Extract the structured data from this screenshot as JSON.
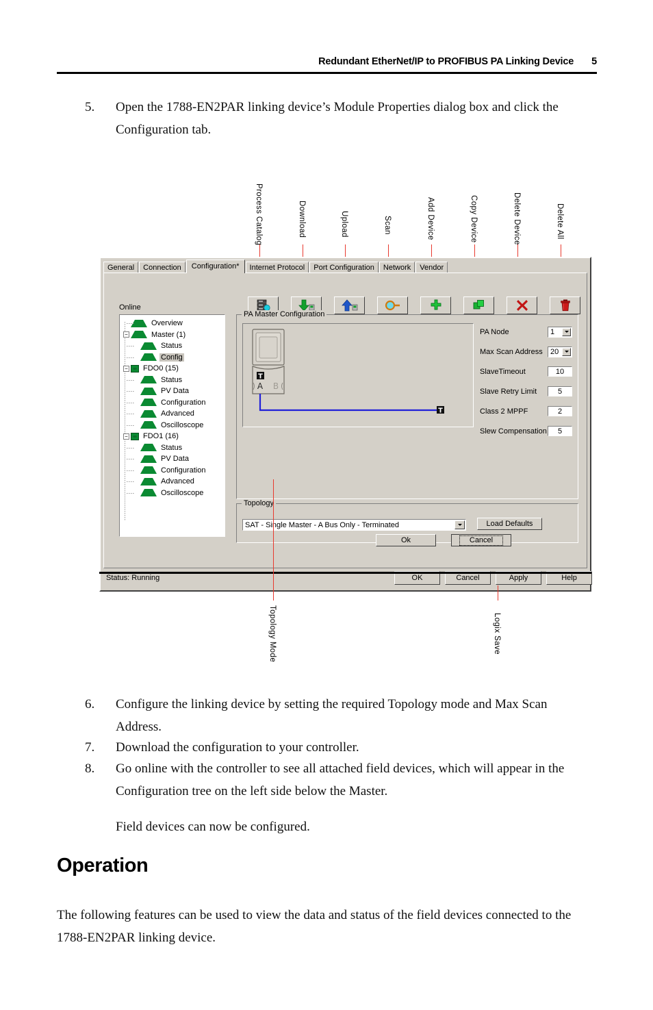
{
  "header": {
    "title": "Redundant EtherNet/IP to PROFIBUS PA Linking Device",
    "page_number": "5"
  },
  "steps": [
    {
      "num": "5.",
      "text": "Open the 1788-EN2PAR linking device’s Module Properties dialog box and click the Configuration tab."
    },
    {
      "num": "6.",
      "text": "Configure the linking device by setting the required Topology mode and Max Scan Address."
    },
    {
      "num": "7.",
      "text": "Download the configuration to your controller."
    },
    {
      "num": "8.",
      "text": "Go online with the controller to see all attached field devices, which will appear in the Configuration tree on the left side below the Master."
    }
  ],
  "note": "Field devices can now be configured.",
  "section": {
    "heading": "Operation",
    "paragraph": "The following features can be used to view the data and status of the field devices connected to the 1788-EN2PAR linking device."
  },
  "callouts": {
    "top": [
      {
        "label": "Process Catalog"
      },
      {
        "label": "Download"
      },
      {
        "label": "Upload"
      },
      {
        "label": "Scan"
      },
      {
        "label": "Add Device"
      },
      {
        "label": "Copy Device"
      },
      {
        "label": "Delete Device"
      },
      {
        "label": "Delete All"
      }
    ],
    "bottom": [
      {
        "label": "Topology Mode"
      },
      {
        "label": "Logix Save"
      }
    ],
    "color": "#e8392e"
  },
  "dialog": {
    "tabs": [
      {
        "label": "General",
        "active": false
      },
      {
        "label": "Connection",
        "active": false
      },
      {
        "label": "Configuration*",
        "active": true
      },
      {
        "label": "Internet Protocol",
        "active": false
      },
      {
        "label": "Port Configuration",
        "active": false
      },
      {
        "label": "Network",
        "active": false
      },
      {
        "label": "Vendor",
        "active": false
      }
    ],
    "toolbar": [
      {
        "name": "process-catalog",
        "icon": "server-stack-icon"
      },
      {
        "name": "download",
        "icon": "down-arrow-icon"
      },
      {
        "name": "upload",
        "icon": "up-arrow-icon"
      },
      {
        "name": "scan",
        "icon": "magnifier-icon"
      },
      {
        "name": "add-device",
        "icon": "plus-icon"
      },
      {
        "name": "copy-device",
        "icon": "copy-icon"
      },
      {
        "name": "delete-device",
        "icon": "x-icon"
      },
      {
        "name": "delete-all",
        "icon": "trash-icon"
      }
    ],
    "online_label": "Online",
    "tree": [
      {
        "label": "Overview",
        "indent": 1,
        "glyph": "triangle",
        "expander": "",
        "selected": false
      },
      {
        "label": "Master (1)",
        "indent": 0,
        "glyph": "triangle",
        "expander": "-",
        "selected": false
      },
      {
        "label": "Status",
        "indent": 1,
        "glyph": "triangle",
        "expander": "",
        "selected": false
      },
      {
        "label": "Config",
        "indent": 1,
        "glyph": "triangle",
        "expander": "",
        "selected": true
      },
      {
        "label": "FDO0 (15)",
        "indent": 0,
        "glyph": "square",
        "expander": "-",
        "selected": false
      },
      {
        "label": "Status",
        "indent": 1,
        "glyph": "triangle",
        "expander": "",
        "selected": false
      },
      {
        "label": "PV Data",
        "indent": 1,
        "glyph": "triangle",
        "expander": "",
        "selected": false
      },
      {
        "label": "Configuration",
        "indent": 1,
        "glyph": "triangle",
        "expander": "",
        "selected": false
      },
      {
        "label": "Advanced",
        "indent": 1,
        "glyph": "triangle",
        "expander": "",
        "selected": false
      },
      {
        "label": "Oscilloscope",
        "indent": 1,
        "glyph": "triangle",
        "expander": "",
        "selected": false
      },
      {
        "label": "FDO1 (16)",
        "indent": 0,
        "glyph": "square",
        "expander": "-",
        "selected": false
      },
      {
        "label": "Status",
        "indent": 1,
        "glyph": "triangle",
        "expander": "",
        "selected": false
      },
      {
        "label": "PV Data",
        "indent": 1,
        "glyph": "triangle",
        "expander": "",
        "selected": false
      },
      {
        "label": "Configuration",
        "indent": 1,
        "glyph": "triangle",
        "expander": "",
        "selected": false
      },
      {
        "label": "Advanced",
        "indent": 1,
        "glyph": "triangle",
        "expander": "",
        "selected": false
      },
      {
        "label": "Oscilloscope",
        "indent": 1,
        "glyph": "triangle",
        "expander": "",
        "selected": false
      }
    ],
    "pa_master": {
      "group_title": "PA Master Configuration",
      "diagram": {
        "terminator_badge": "T",
        "port_a": "A",
        "port_b": "B",
        "bus_end_badge": "T",
        "bus_color": "#2020d8"
      },
      "fields": [
        {
          "label": "PA Node",
          "value": "1",
          "type": "combo"
        },
        {
          "label": "Max Scan Address",
          "value": "20",
          "type": "combo"
        },
        {
          "label": "SlaveTimeout",
          "value": "10",
          "type": "text"
        },
        {
          "label": "Slave Retry Limit",
          "value": "5",
          "type": "text"
        },
        {
          "label": "Class 2 MPPF",
          "value": "2",
          "type": "text"
        },
        {
          "label": "Slew Compensation",
          "value": "5",
          "type": "text"
        }
      ]
    },
    "topology": {
      "group_title": "Topology",
      "value": "SAT   -   Single Master - A Bus Only - Terminated"
    },
    "load_defaults_label": "Load Defaults",
    "inner_ok_label": "Ok",
    "inner_cancel_label": "Cancel",
    "status_text": "Status: Running",
    "status_buttons": [
      {
        "label": "OK"
      },
      {
        "label": "Cancel"
      },
      {
        "label": "Apply"
      },
      {
        "label": "Help"
      }
    ]
  }
}
